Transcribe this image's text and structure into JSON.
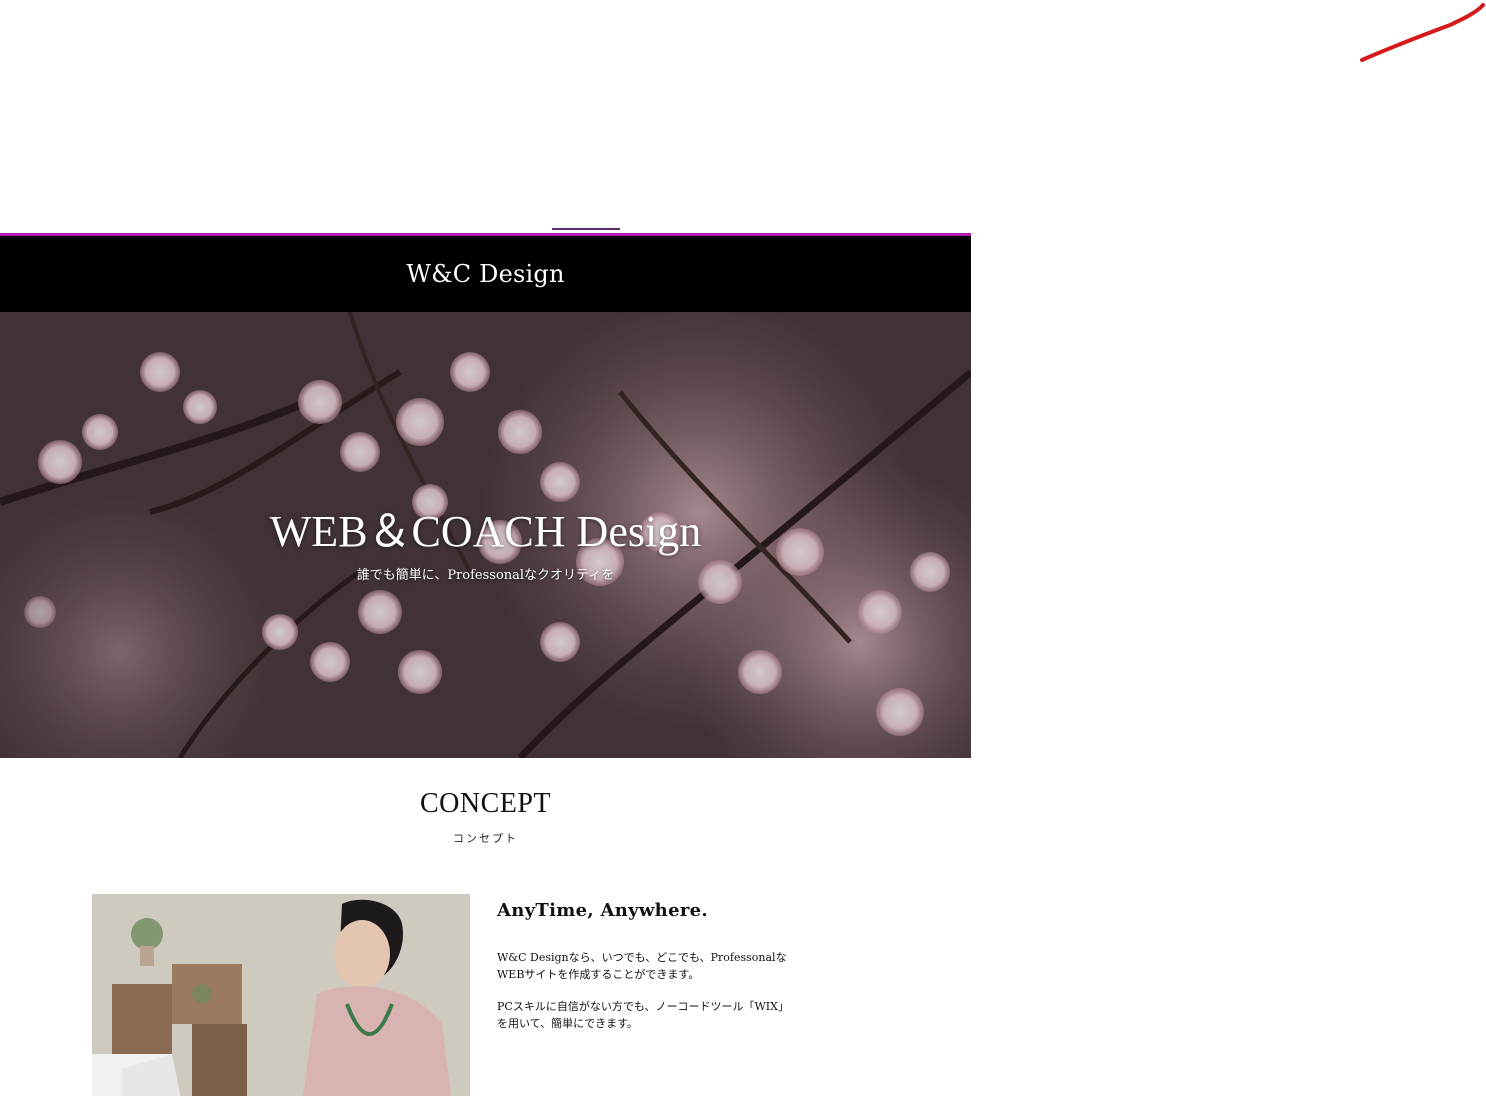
{
  "header": {
    "site_title": "W&C Design"
  },
  "hero": {
    "title": "WEB＆COACH Design",
    "subtitle": "誰でも簡単に、Professonalなクオリティを"
  },
  "concept": {
    "title": "CONCEPT",
    "subtitle": "コンセプト",
    "heading": "AnyTime, Anywhere.",
    "paragraph1": "W&C Designなら、いつでも、どこでも、Professonalな WEBサイトを作成することができます。",
    "paragraph2": "PCスキルに自信がない方でも、ノーコードツール「WIX」を用いて、簡単にできます。"
  },
  "colors": {
    "header_bg": "#000000",
    "accent_border": "#b21ab8",
    "annotation_stroke": "#d41a1a"
  }
}
